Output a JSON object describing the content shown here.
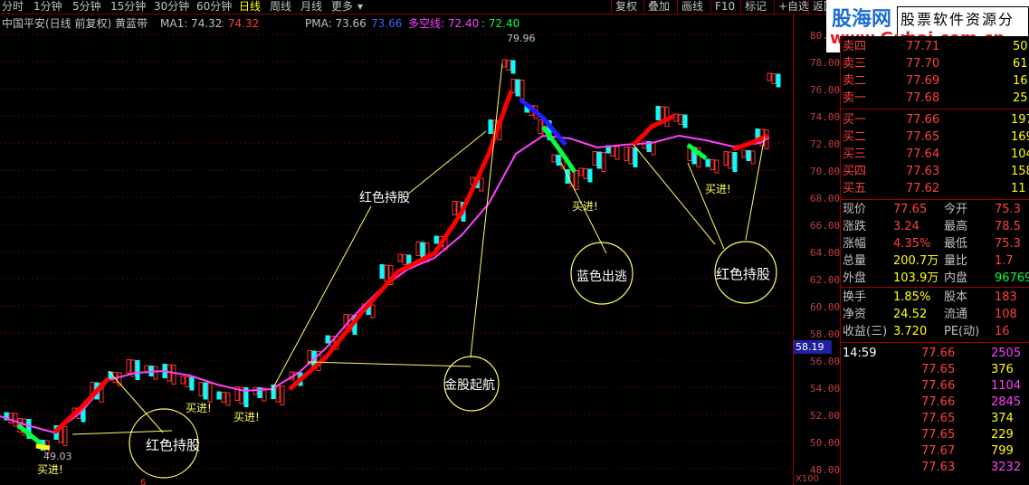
{
  "toolbar": {
    "periods": [
      "分时",
      "1分钟",
      "5分钟",
      "15分钟",
      "30分钟",
      "60分钟",
      "日线",
      "周线",
      "月线",
      "更多"
    ],
    "active_period": "日线",
    "more_arrow": "▾",
    "buttons": [
      "复权",
      "叠加",
      "画线",
      "F10",
      "标记",
      "+自选",
      "返回"
    ]
  },
  "logo": {
    "brand": "股海网",
    "tagline": "股票软件资源分享",
    "url": "www.Guhai.com.cn"
  },
  "infobar": {
    "stock": "中国平安(日线 前复权) 黄蓝带",
    "ma1_label": "MA1: 74.32",
    "ma1_extra": ": 74.32",
    "pma_label": "PMA: 73.66",
    "pma_extra": "73.66",
    "dk_label": "多空线: 72.40",
    "dk_extra": ": 72.40"
  },
  "axis": {
    "ticks": [
      "80.00",
      "78.00",
      "76.00",
      "74.00",
      "72.00",
      "70.00",
      "68.00",
      "66.00",
      "64.00",
      "62.00",
      "60.00",
      "58.00",
      "56.00",
      "54.00",
      "52.00",
      "50.00",
      "48.00"
    ],
    "cursor_value": "58.19",
    "multiplier": "X100"
  },
  "chart_labels": {
    "high": "79.96",
    "low": "49.03",
    "hold_red": "红色持股",
    "hold_red_2": "红色持股",
    "hold_red_3": "红色持股",
    "golden": "金股起航",
    "blue_exit": "蓝色出逃",
    "buy": "买进!",
    "bottom_marker": "6"
  },
  "order_book": {
    "sells": [
      {
        "label": "卖四",
        "price": "77.71",
        "vol": "50"
      },
      {
        "label": "卖三",
        "price": "77.70",
        "vol": "61"
      },
      {
        "label": "卖二",
        "price": "77.69",
        "vol": "16"
      },
      {
        "label": "卖一",
        "price": "77.68",
        "vol": "25"
      }
    ],
    "buys": [
      {
        "label": "买一",
        "price": "77.66",
        "vol": "197"
      },
      {
        "label": "买二",
        "price": "77.65",
        "vol": "169"
      },
      {
        "label": "买三",
        "price": "77.64",
        "vol": "104"
      },
      {
        "label": "买四",
        "price": "77.63",
        "vol": "158"
      },
      {
        "label": "买五",
        "price": "77.62",
        "vol": "11"
      }
    ]
  },
  "quote": [
    {
      "k1": "现价",
      "v1": "77.65",
      "k2": "今开",
      "v2": "75.3"
    },
    {
      "k1": "涨跌",
      "v1": "3.24",
      "k2": "最高",
      "v2": "78.5"
    },
    {
      "k1": "涨幅",
      "v1": "4.35%",
      "k2": "最低",
      "v2": "75.3"
    },
    {
      "k1": "总量",
      "v1": "200.7万",
      "k2": "量比",
      "v2": "1.7"
    },
    {
      "k1": "外盘",
      "v1": "103.9万",
      "k2": "内盘",
      "v2": "96769"
    },
    {
      "k1": "换手",
      "v1": "1.85%",
      "k2": "股本",
      "v2": "183"
    },
    {
      "k1": "净资",
      "v1": "24.52",
      "k2": "流通",
      "v2": "108"
    },
    {
      "k1": "收益(三)",
      "v1": "3.720",
      "k2": "PE(动)",
      "v2": "16"
    }
  ],
  "ticks": [
    {
      "time": "14:59",
      "price": "77.66",
      "vol": "2505"
    },
    {
      "time": "",
      "price": "77.65",
      "vol": "376"
    },
    {
      "time": "",
      "price": "77.66",
      "vol": "1104"
    },
    {
      "time": "",
      "price": "77.66",
      "vol": "2845"
    },
    {
      "time": "",
      "price": "77.65",
      "vol": "374"
    },
    {
      "time": "",
      "price": "77.65",
      "vol": "229"
    },
    {
      "time": "",
      "price": "77.67",
      "vol": "799"
    },
    {
      "time": "",
      "price": "77.63",
      "vol": "3232"
    }
  ],
  "colors": {
    "up": "#ff3030",
    "down": "#00ffff",
    "ma": "#ff40ff",
    "yellow": "#ffff00",
    "blue": "#1e1eff",
    "green": "#00ff40"
  }
}
